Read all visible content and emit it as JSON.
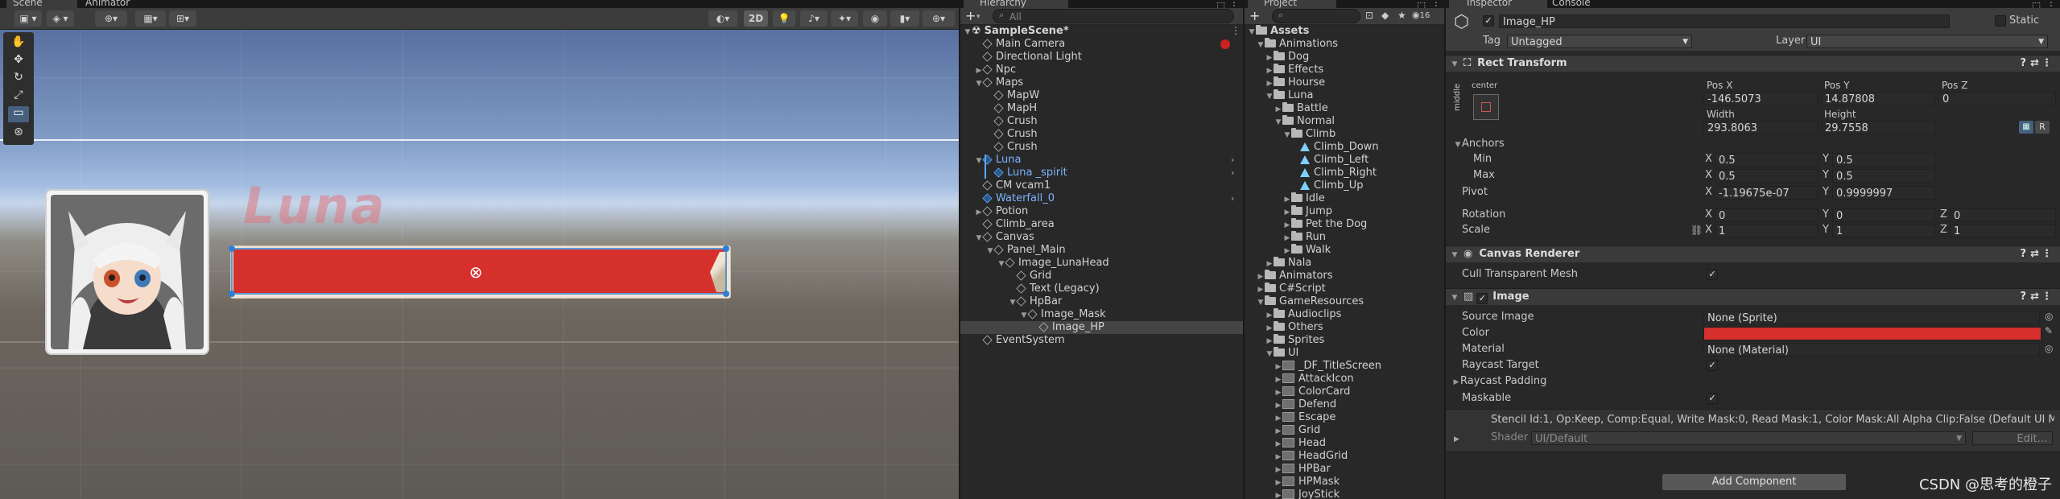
{
  "tabs": {
    "scene": "Scene",
    "animator": "Animator",
    "hierarchy": "Hierarchy",
    "project": "Project",
    "inspector": "Inspector",
    "console": "Console"
  },
  "scene": {
    "mode_2d": "2D",
    "watermark": "Luna"
  },
  "hierarchy": {
    "search_placeholder": "All",
    "add_label": "+",
    "scene_name": "SampleScene*",
    "items": [
      {
        "label": "Main Camera",
        "depth": 1,
        "arrow": "",
        "icon": "cube"
      },
      {
        "label": "Directional Light",
        "depth": 1,
        "arrow": "",
        "icon": "cube"
      },
      {
        "label": "Npc",
        "depth": 1,
        "arrow": "▶",
        "icon": "cube"
      },
      {
        "label": "Maps",
        "depth": 1,
        "arrow": "▼",
        "icon": "cube"
      },
      {
        "label": "MapW",
        "depth": 2,
        "arrow": "",
        "icon": "cube"
      },
      {
        "label": "MapH",
        "depth": 2,
        "arrow": "",
        "icon": "cube"
      },
      {
        "label": "Crush",
        "depth": 2,
        "arrow": "",
        "icon": "cube"
      },
      {
        "label": "Crush",
        "depth": 2,
        "arrow": "",
        "icon": "cube"
      },
      {
        "label": "Crush",
        "depth": 2,
        "arrow": "",
        "icon": "cube"
      },
      {
        "label": "Luna",
        "depth": 1,
        "arrow": "▼",
        "icon": "prefab",
        "blue": true
      },
      {
        "label": "Luna _spirit",
        "depth": 2,
        "arrow": "",
        "icon": "prefab",
        "blue": true
      },
      {
        "label": "CM vcam1",
        "depth": 1,
        "arrow": "",
        "icon": "cube"
      },
      {
        "label": "Waterfall_0",
        "depth": 1,
        "arrow": "",
        "icon": "prefab",
        "blue": true
      },
      {
        "label": "Potion",
        "depth": 1,
        "arrow": "▶",
        "icon": "cube"
      },
      {
        "label": "Climb_area",
        "depth": 1,
        "arrow": "",
        "icon": "cube"
      },
      {
        "label": "Canvas",
        "depth": 1,
        "arrow": "▼",
        "icon": "cube"
      },
      {
        "label": "Panel_Main",
        "depth": 2,
        "arrow": "▼",
        "icon": "cube"
      },
      {
        "label": "Image_LunaHead",
        "depth": 3,
        "arrow": "▼",
        "icon": "cube"
      },
      {
        "label": "Grid",
        "depth": 4,
        "arrow": "",
        "icon": "cube"
      },
      {
        "label": "Text (Legacy)",
        "depth": 4,
        "arrow": "",
        "icon": "cube"
      },
      {
        "label": "HpBar",
        "depth": 4,
        "arrow": "▼",
        "icon": "cube"
      },
      {
        "label": "Image_Mask",
        "depth": 5,
        "arrow": "▼",
        "icon": "cube"
      },
      {
        "label": "Image_HP",
        "depth": 6,
        "arrow": "",
        "icon": "cube",
        "selected": true
      },
      {
        "label": "EventSystem",
        "depth": 1,
        "arrow": "",
        "icon": "cube"
      }
    ]
  },
  "project": {
    "add_label": "+",
    "badge": "16",
    "root": "Assets",
    "items": [
      {
        "label": "Animations",
        "depth": 1,
        "arrow": "▼",
        "icon": "folder"
      },
      {
        "label": "Dog",
        "depth": 2,
        "arrow": "▶",
        "icon": "folder"
      },
      {
        "label": "Effects",
        "depth": 2,
        "arrow": "▶",
        "icon": "folder"
      },
      {
        "label": "Hourse",
        "depth": 2,
        "arrow": "▶",
        "icon": "folder"
      },
      {
        "label": "Luna",
        "depth": 2,
        "arrow": "▼",
        "icon": "folder"
      },
      {
        "label": "Battle",
        "depth": 3,
        "arrow": "▶",
        "icon": "folder"
      },
      {
        "label": "Normal",
        "depth": 3,
        "arrow": "▼",
        "icon": "folder"
      },
      {
        "label": "Climb",
        "depth": 4,
        "arrow": "▼",
        "icon": "folder"
      },
      {
        "label": "Climb_Down",
        "depth": 5,
        "arrow": "",
        "icon": "anim"
      },
      {
        "label": "Climb_Left",
        "depth": 5,
        "arrow": "",
        "icon": "anim"
      },
      {
        "label": "Climb_Right",
        "depth": 5,
        "arrow": "",
        "icon": "anim"
      },
      {
        "label": "Climb_Up",
        "depth": 5,
        "arrow": "",
        "icon": "anim"
      },
      {
        "label": "Idle",
        "depth": 4,
        "arrow": "▶",
        "icon": "folder"
      },
      {
        "label": "Jump",
        "depth": 4,
        "arrow": "▶",
        "icon": "folder"
      },
      {
        "label": "Pet the Dog",
        "depth": 4,
        "arrow": "▶",
        "icon": "folder"
      },
      {
        "label": "Run",
        "depth": 4,
        "arrow": "▶",
        "icon": "folder"
      },
      {
        "label": "Walk",
        "depth": 4,
        "arrow": "▶",
        "icon": "folder"
      },
      {
        "label": "Nala",
        "depth": 2,
        "arrow": "▶",
        "icon": "folder"
      },
      {
        "label": "Animators",
        "depth": 1,
        "arrow": "▶",
        "icon": "folder"
      },
      {
        "label": "C#Script",
        "depth": 1,
        "arrow": "▶",
        "icon": "folder"
      },
      {
        "label": "GameResources",
        "depth": 1,
        "arrow": "▼",
        "icon": "folder"
      },
      {
        "label": "Audioclips",
        "depth": 2,
        "arrow": "▶",
        "icon": "folder"
      },
      {
        "label": "Others",
        "depth": 2,
        "arrow": "▶",
        "icon": "folder"
      },
      {
        "label": "Sprites",
        "depth": 2,
        "arrow": "▶",
        "icon": "folder"
      },
      {
        "label": "UI",
        "depth": 2,
        "arrow": "▼",
        "icon": "folder"
      },
      {
        "label": "_DF_TitleScreen",
        "depth": 3,
        "arrow": "▶",
        "icon": "sprite"
      },
      {
        "label": "AttackIcon",
        "depth": 3,
        "arrow": "▶",
        "icon": "sprite"
      },
      {
        "label": "ColorCard",
        "depth": 3,
        "arrow": "▶",
        "icon": "sprite"
      },
      {
        "label": "Defend",
        "depth": 3,
        "arrow": "▶",
        "icon": "sprite"
      },
      {
        "label": "Escape",
        "depth": 3,
        "arrow": "▶",
        "icon": "sprite"
      },
      {
        "label": "Grid",
        "depth": 3,
        "arrow": "▶",
        "icon": "sprite"
      },
      {
        "label": "Head",
        "depth": 3,
        "arrow": "▶",
        "icon": "sprite"
      },
      {
        "label": "HeadGrid",
        "depth": 3,
        "arrow": "▶",
        "icon": "sprite"
      },
      {
        "label": "HPBar",
        "depth": 3,
        "arrow": "▶",
        "icon": "sprite"
      },
      {
        "label": "HPMask",
        "depth": 3,
        "arrow": "▶",
        "icon": "sprite"
      },
      {
        "label": "JoyStick",
        "depth": 3,
        "arrow": "▶",
        "icon": "sprite"
      }
    ]
  },
  "inspector": {
    "object_name": "Image_HP",
    "static_label": "Static",
    "tag_label": "Tag",
    "tag_value": "Untagged",
    "layer_label": "Layer",
    "layer_value": "UI",
    "rect_transform": {
      "title": "Rect Transform",
      "anchor_preset_h": "center",
      "anchor_preset_v": "middle",
      "pos_x_label": "Pos X",
      "pos_x": "-146.5073",
      "pos_y_label": "Pos Y",
      "pos_y": "14.87808",
      "pos_z_label": "Pos Z",
      "pos_z": "0",
      "width_label": "Width",
      "width": "293.8063",
      "height_label": "Height",
      "height": "29.7558",
      "r_label": "R",
      "anchors_label": "Anchors",
      "min_label": "Min",
      "min_x": "0.5",
      "min_y": "0.5",
      "max_label": "Max",
      "max_x": "0.5",
      "max_y": "0.5",
      "pivot_label": "Pivot",
      "pivot_x": "-1.19675e-07",
      "pivot_y": "0.9999997",
      "rotation_label": "Rotation",
      "rot_x": "0",
      "rot_y": "0",
      "rot_z": "0",
      "scale_label": "Scale",
      "scale_x": "1",
      "scale_y": "1",
      "scale_z": "1",
      "x": "X",
      "y": "Y",
      "z": "Z"
    },
    "canvas_renderer": {
      "title": "Canvas Renderer",
      "cull_label": "Cull Transparent Mesh"
    },
    "image": {
      "title": "Image",
      "source_label": "Source Image",
      "source_value": "None (Sprite)",
      "color_label": "Color",
      "color_value": "#d6302d",
      "material_label": "Material",
      "material_value": "None (Material)",
      "raycast_label": "Raycast Target",
      "padding_label": "Raycast Padding",
      "maskable_label": "Maskable"
    },
    "stencil_text": "Stencil Id:1, Op:Keep, Comp:Equal, Write Mask:0, Read Mask:1, Color Mask:All Alpha Clip:False (Default UI M",
    "shader_label": "Shader",
    "shader_value": "UI/Default",
    "edit_label": "Edit...",
    "add_component": "Add Component",
    "watermark": "CSDN @思考的橙子"
  },
  "colors": {
    "hp_red": "#d6302d",
    "selection": "#444444",
    "prefab_blue": "#7cb3ff"
  }
}
